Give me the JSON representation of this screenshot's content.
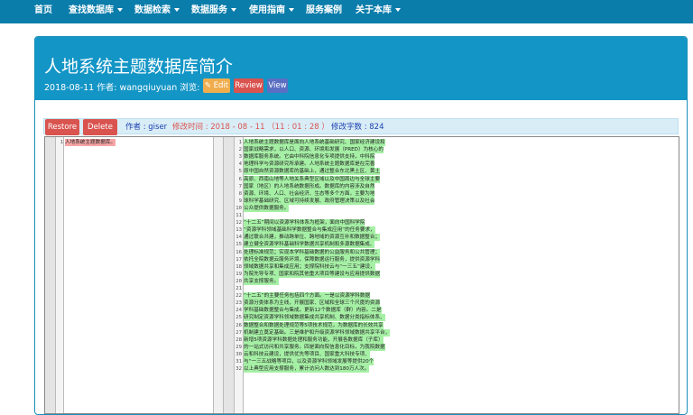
{
  "nav": {
    "items": [
      {
        "label": "首页",
        "dropdown": false
      },
      {
        "label": "查找数据库",
        "dropdown": true
      },
      {
        "label": "数据检索",
        "dropdown": true
      },
      {
        "label": "数据服务",
        "dropdown": true
      },
      {
        "label": "使用指南",
        "dropdown": true
      },
      {
        "label": "服务案例",
        "dropdown": false
      },
      {
        "label": "关于本库",
        "dropdown": true
      }
    ]
  },
  "article": {
    "title": "人地系统主题数据库简介",
    "meta": "2018-08-11 作者: wangqiuyuan 浏览: 1 次",
    "buttons": {
      "edit": "Edit",
      "review": "Review",
      "view": "View"
    }
  },
  "toolbar": {
    "restore": "Restore",
    "delete": "Delete",
    "author": "作者 : giser",
    "modified": "修改时间 : 2018 - 08 - 11 （11 : 01 : 28 ）",
    "wordcount": "修改字数 : 824"
  },
  "diff": {
    "left_lines": [
      {
        "n": "1",
        "text": "人地系统主题数据库。"
      }
    ],
    "right_lines": [
      {
        "n": "1",
        "text": "人地系统主题数据库是面向人地系统基础研究、国家经济建设和"
      },
      {
        "n": "2",
        "text": "国家战略需求，以人口、资源、环境和发展（PRED）为核心的"
      },
      {
        "n": "3",
        "text": "数据库服务系统。它由中科院信息化专项提供支持，中科院"
      },
      {
        "n": "4",
        "text": "地理科学与资源研究所承建。人地系统主题数据库是在完善"
      },
      {
        "n": "5",
        "text": "原中国自然资源数据库的基础上，通过整合东北黑土区、黄土"
      },
      {
        "n": "6",
        "text": "高原、西南山地等人地关系典型区域以及中国周边与全球主要"
      },
      {
        "n": "7",
        "text": "国家（地区）的人地系统数据形成。数据库的内容涉及自然"
      },
      {
        "n": "8",
        "text": "资源、环境、人口、社会经济、生态等多个方面，主要为地"
      },
      {
        "n": "9",
        "text": "球科学基础研究、区域可持续发展、政府管理决策以及社会"
      },
      {
        "n": "10",
        "text": "公众提供数据服务。"
      },
      {
        "n": "11",
        "text": ""
      },
      {
        "n": "12",
        "text": "“十二五”期间以资源学科体系为框架，面向中国科学院"
      },
      {
        "n": "13",
        "text": "“资源学科领域基础科学数据整合与集成应用”的任务要求，"
      },
      {
        "n": "14",
        "text": "通过联合共建，推动跨单位、跨地域的资源互补和数据整合；"
      },
      {
        "n": "15",
        "text": "建立健全资源学科基础科学数据共享机制和多源数据集成、"
      },
      {
        "n": "16",
        "text": "处理标准规范；实现本学科基础数据的公益服务和公共管理；"
      },
      {
        "n": "17",
        "text": "依托全院数据云服务环境，保障数据运行服务，提供资源学科"
      },
      {
        "n": "18",
        "text": "领域数据共享和集成应用；支撑院科技云与“一三五”建设，"
      },
      {
        "n": "19",
        "text": "为院先导专项、国家和院其他重大项目等建设与应用提供数据"
      },
      {
        "n": "20",
        "text": "共享支撑服务。"
      },
      {
        "n": "21",
        "text": ""
      },
      {
        "n": "22",
        "text": "“十二五”的主要任务包括四个方面。一是以资源学科数据"
      },
      {
        "n": "23",
        "text": "资源分类体系为主线，开展国家、区域和全球三个尺度的资源"
      },
      {
        "n": "24",
        "text": "学科基础数据整合与集成，更新12个数据库（群）内容。二是"
      },
      {
        "n": "25",
        "text": "研究制定资源学科领域数据集成共享机制、数据分类指标体系、"
      },
      {
        "n": "26",
        "text": "数据整合和数据处理规范等5项技术规范，为数据库的长效共享"
      },
      {
        "n": "27",
        "text": "机制建立奠定基础。三是维护和升级资源学科领域数据共享平台，"
      },
      {
        "n": "28",
        "text": "新增5项资源学科数据处理和服务功能，开展各数据库（子库）"
      },
      {
        "n": "29",
        "text": "的一站式访问和共享服务。四是面向院信息化目标，为我院数据"
      },
      {
        "n": "30",
        "text": "云和科技云建设，提供优先等项目、国家重大科技专项、"
      },
      {
        "n": "31",
        "text": "与“一三五战略等项目，以及资源学科领域发展等提供20个"
      },
      {
        "n": "32",
        "text": "以上典型应用支撑服务，累计访问人数达到180万人次。"
      }
    ]
  },
  "colors": {
    "nav_bg": "#0b7dab",
    "header_bg": "#1395c6",
    "edit": "#f0ad4e",
    "review": "#d9534f",
    "view": "#5b6fc2",
    "added": "#a6f0a6",
    "removed": "#f7a6a6"
  }
}
